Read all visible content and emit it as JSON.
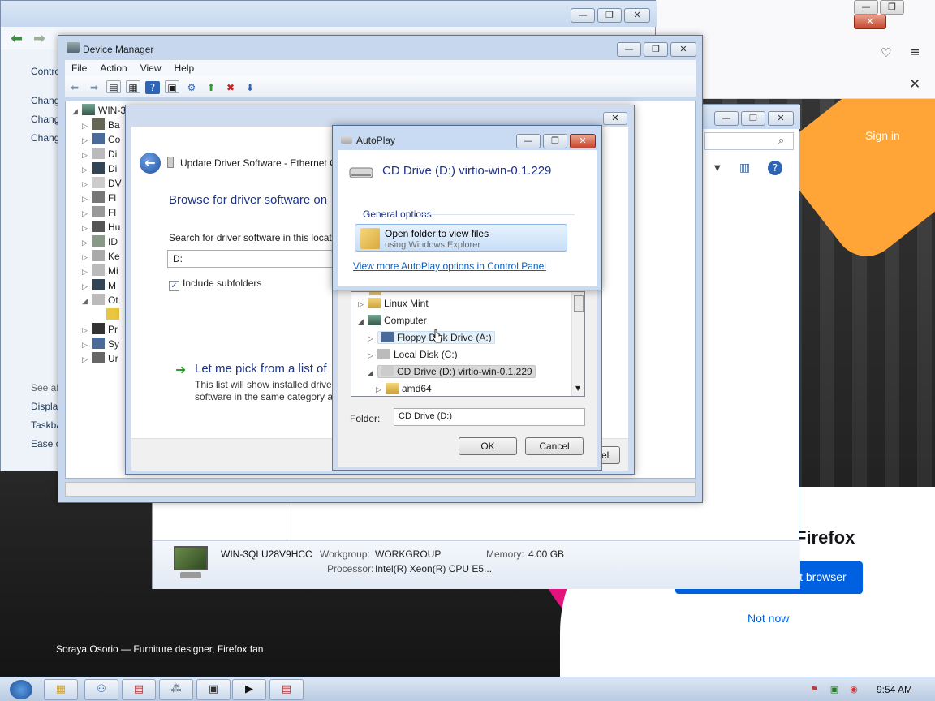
{
  "firefox": {
    "sign_in": "Sign in",
    "brand_text": "Firefox",
    "default_button": "lt browser",
    "not_now": "Not now",
    "credit": "Soraya Osorio — Furniture designer, Firefox fan",
    "colors": {
      "orange": "#ffa436",
      "pink": "#e3127d",
      "blue": "#0061e0"
    }
  },
  "control_panel": {
    "left_links": [
      "Contro",
      "Chang",
      "Chang",
      "Chang"
    ],
    "see_also": "See als",
    "see_also_links": [
      "Display",
      "Taskba",
      "Ease o"
    ]
  },
  "system": {
    "computer_name": "WIN-3QLU28V9HCC",
    "workgroup_label": "Workgroup:",
    "workgroup_value": "WORKGROUP",
    "memory_label": "Memory:",
    "memory_value": "4.00 GB",
    "processor_label": "Processor:",
    "processor_value": "Intel(R) Xeon(R) CPU E5..."
  },
  "device_manager": {
    "title": "Device Manager",
    "menu": [
      "File",
      "Action",
      "View",
      "Help"
    ],
    "root": "WIN-3",
    "items": [
      "Ba",
      "Co",
      "Di",
      "Di",
      "DV",
      "Fl",
      "Fl",
      "Hu",
      "ID",
      "Ke",
      "Mi",
      "M",
      "Ot",
      "",
      "Pr",
      "Sy",
      "Ur"
    ]
  },
  "update_driver": {
    "title": "Update Driver Software - Ethernet C",
    "heading": "Browse for driver software on",
    "search_label": "Search for driver software in this locatio",
    "path_value": "D:",
    "include_subfolders": "Include subfolders",
    "pick_title": "Let me pick from a list of",
    "pick_desc_1": "This list will show installed driver",
    "pick_desc_2": "software in the same category as t",
    "footer_button": "el"
  },
  "browse_folder": {
    "tree": [
      {
        "label": "Linux Mint",
        "icon": "folder-icon"
      },
      {
        "label": "Computer",
        "icon": "computer-icon"
      },
      {
        "label": "Floppy Disk Drive (A:)",
        "icon": "floppy-icon"
      },
      {
        "label": "Local Disk (C:)",
        "icon": "disk-icon"
      },
      {
        "label": "CD Drive (D:) virtio-win-0.1.229",
        "icon": "cd-drive-icon"
      },
      {
        "label": "amd64",
        "icon": "folder-icon"
      }
    ],
    "folder_label": "Folder:",
    "folder_value": "CD Drive (D:)",
    "ok": "OK",
    "cancel": "Cancel"
  },
  "autoplay": {
    "title": "AutoPlay",
    "drive_name": "CD Drive (D:) virtio-win-0.1.229",
    "section": "General options",
    "option_main": "Open folder to view files",
    "option_sub": "using Windows Explorer",
    "more_link": "View more AutoPlay options in Control Panel"
  },
  "taskbar": {
    "clock": "9:54 AM"
  }
}
